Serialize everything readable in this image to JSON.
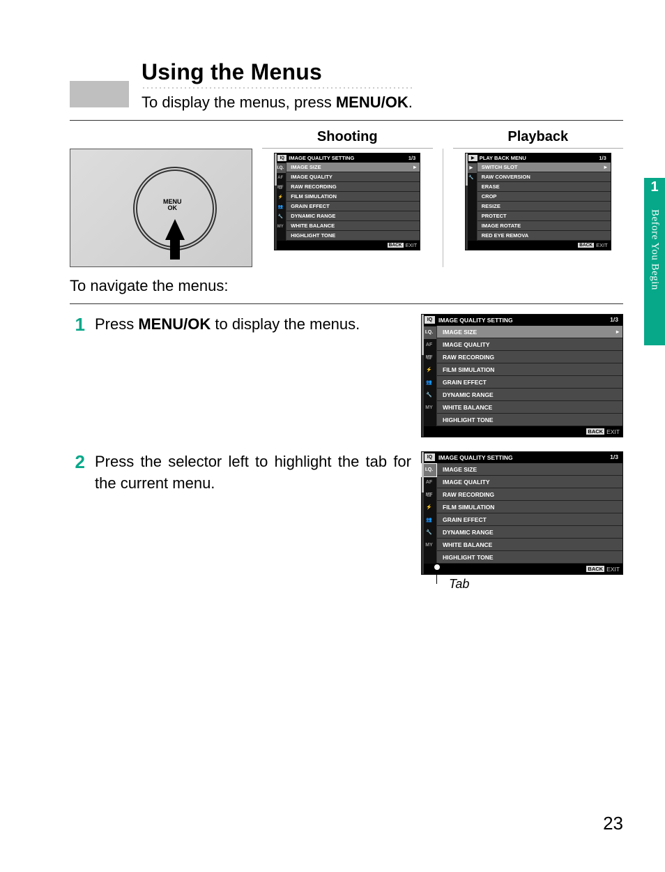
{
  "side": {
    "num": "1",
    "label": "Before You Begin"
  },
  "title": "Using the Menus",
  "intro_pre": "To display the menus, press ",
  "intro_bold": "MENU/OK",
  "intro_post": ".",
  "cols": {
    "shooting": "Shooting",
    "playback": "Playback"
  },
  "iq_menu": {
    "icon": "IQ",
    "title": "IMAGE QUALITY SETTING",
    "page": "1/3",
    "tabs": [
      "I.Q.",
      "AF MF",
      "▢",
      "⚡",
      "👥",
      "🔧",
      "MY"
    ],
    "items": [
      "IMAGE SIZE",
      "IMAGE QUALITY",
      "RAW RECORDING",
      "FILM SIMULATION",
      "GRAIN EFFECT",
      "DYNAMIC RANGE",
      "WHITE BALANCE",
      "HIGHLIGHT TONE"
    ],
    "back": "BACK",
    "exit": "EXIT"
  },
  "pb_menu": {
    "icon": "▶",
    "title": "PLAY BACK MENU",
    "page": "1/3",
    "tabs": [
      "▶",
      "🔧"
    ],
    "items": [
      "SWITCH SLOT",
      "RAW CONVERSION",
      "ERASE",
      "CROP",
      "RESIZE",
      "PROTECT",
      "IMAGE ROTATE",
      "RED EYE REMOVA"
    ],
    "back": "BACK",
    "exit": "EXIT"
  },
  "nav_intro": "To navigate the menus:",
  "steps": {
    "s1": {
      "num": "1",
      "pre": "Press ",
      "bold": "MENU/OK",
      "post": " to display the menus."
    },
    "s2": {
      "num": "2",
      "txt": "Press the selector left to high­light the tab for the current menu."
    }
  },
  "tab_label": "Tab",
  "page_num": "23",
  "camera_button": "MENU/OK"
}
